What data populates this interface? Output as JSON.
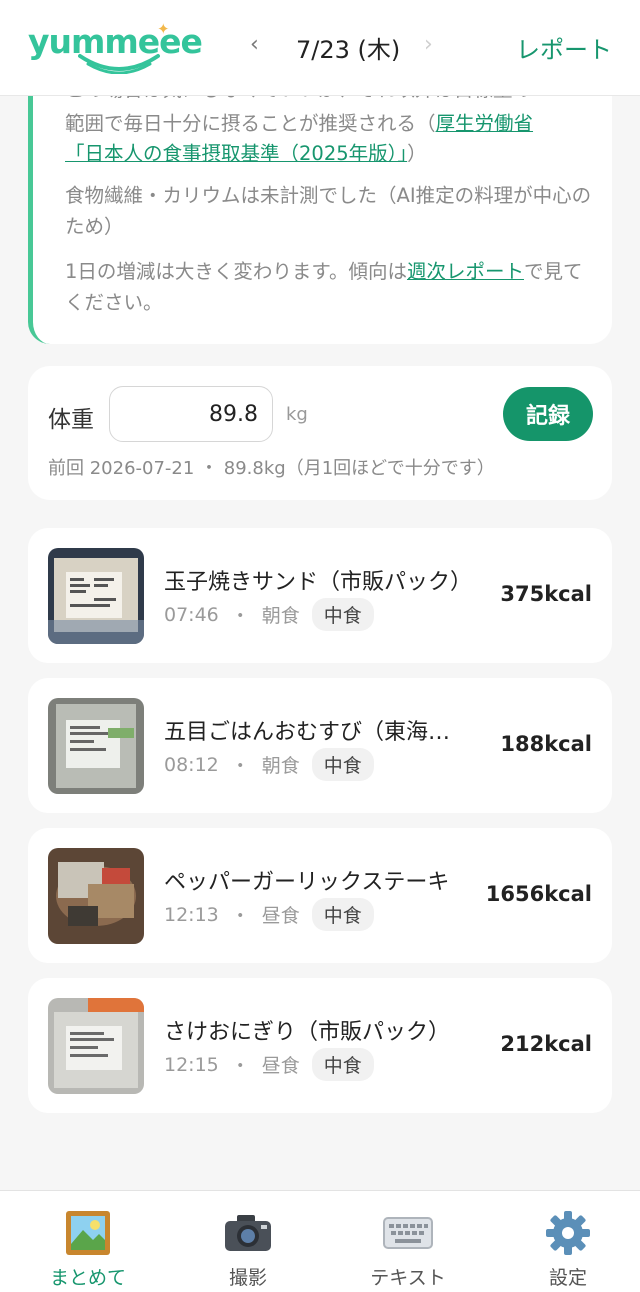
{
  "header": {
    "logo": "yummeee",
    "prev_arrow": "‹",
    "date": "7/23 (木)",
    "next_arrow": "›",
    "report_label": "レポート"
  },
  "info": {
    "line1_partial": "この場合は気にしなくていいが、それ以外は目標量の",
    "line2_prefix": "範囲で毎日十分に摂ることが推奨される（",
    "line2_link": "厚生労働省",
    "line3_link": "「日本人の食事摂取基準（2025年版）」",
    "line3_suffix": "）",
    "note1": "食物繊維・カリウムは未計測でした（AI推定の料理が中心のため）",
    "note2_prefix": "1日の増減は大きく変わります。傾向は",
    "note2_link": "週次レポート",
    "note2_suffix": "で見てください。"
  },
  "weight": {
    "label": "体重",
    "value": "89.8",
    "unit": "kg",
    "record_label": "記録",
    "previous": "前回 2026-07-21 ・ 89.8kg（月1回ほどで十分です）"
  },
  "meals": [
    {
      "title": "玉子焼きサンド（市販パック）",
      "time": "07:46",
      "meal": "朝食",
      "tag": "中食",
      "kcal": "375kcal"
    },
    {
      "title": "五目ごはんおむすび（東海…",
      "time": "08:12",
      "meal": "朝食",
      "tag": "中食",
      "kcal": "188kcal"
    },
    {
      "title": "ペッパーガーリックステーキ",
      "time": "12:13",
      "meal": "昼食",
      "tag": "中食",
      "kcal": "1656kcal"
    },
    {
      "title": "さけおにぎり（市販パック）",
      "time": "12:15",
      "meal": "昼食",
      "tag": "中食",
      "kcal": "212kcal"
    }
  ],
  "meta_separator": "・",
  "nav": {
    "summary": "まとめて",
    "camera": "撮影",
    "text": "テキスト",
    "settings": "設定"
  },
  "colors": {
    "accent": "#17966e",
    "brand": "#34c49b",
    "record_button": "#15956a"
  },
  "icons": [
    "picture-icon",
    "camera-icon",
    "keyboard-icon",
    "gear-icon"
  ]
}
